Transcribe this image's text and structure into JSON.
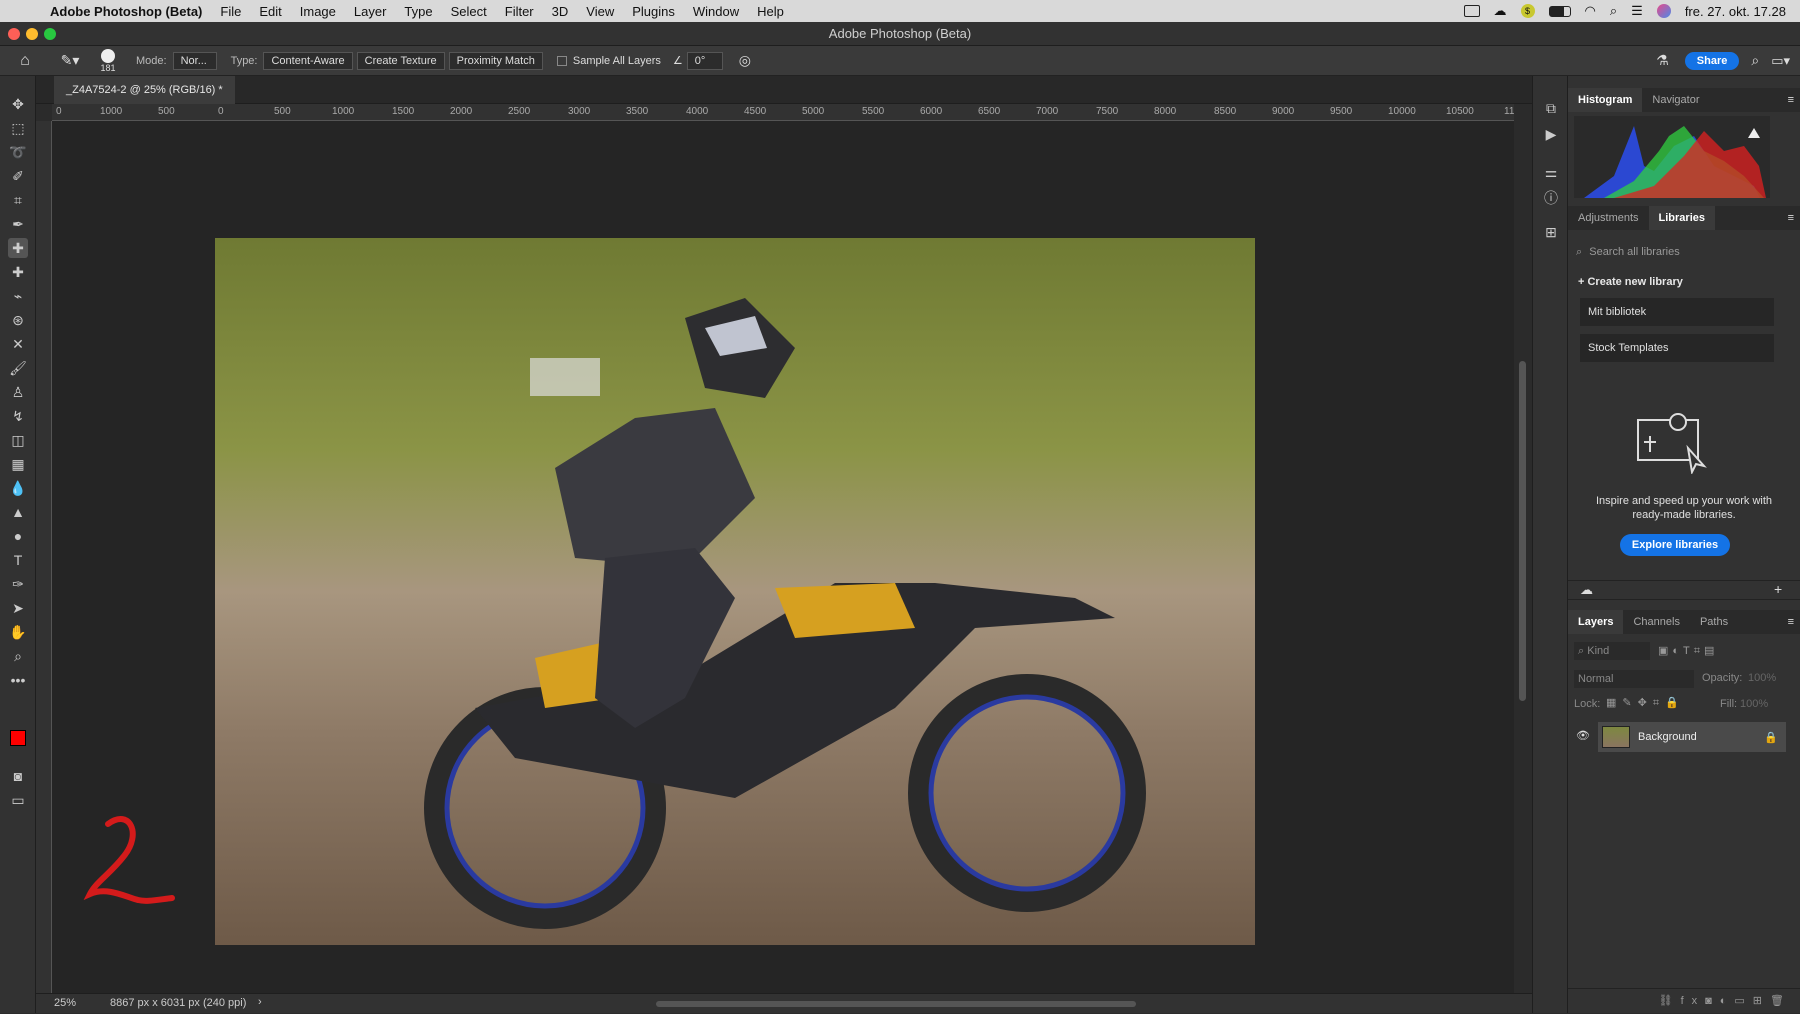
{
  "menubar": {
    "app": "Adobe Photoshop (Beta)",
    "items": [
      "File",
      "Edit",
      "Image",
      "Layer",
      "Type",
      "Select",
      "Filter",
      "3D",
      "View",
      "Plugins",
      "Window",
      "Help"
    ],
    "clock": "fre. 27. okt. 17.28"
  },
  "window": {
    "title": "Adobe Photoshop (Beta)"
  },
  "options": {
    "brush_size": "181",
    "mode_label": "Mode:",
    "mode_value": "Nor...",
    "type_label": "Type:",
    "type_buttons": [
      "Content-Aware",
      "Create Texture",
      "Proximity Match"
    ],
    "sample_all": "Sample All Layers",
    "angle": "0°",
    "share": "Share"
  },
  "document": {
    "tab": "_Z4A7524-2 @ 25% (RGB/16) *",
    "zoom": "25%",
    "info": "8867 px x 6031 px (240 ppi)"
  },
  "ruler": {
    "h_labels": [
      "0",
      "1000",
      "500",
      "0",
      "500",
      "1000",
      "1500",
      "2000",
      "2500",
      "3000",
      "3500",
      "4000",
      "4500",
      "5000",
      "5500",
      "6000",
      "6500",
      "7000",
      "7500",
      "8000",
      "8500",
      "9000",
      "9500",
      "10000",
      "10500",
      "11"
    ]
  },
  "histogram_tabs": {
    "active": "Histogram",
    "other": "Navigator"
  },
  "libraries": {
    "tabs": [
      "Adjustments",
      "Libraries"
    ],
    "search_placeholder": "Search all libraries",
    "create": "Create new library",
    "items": [
      "Mit bibliotek",
      "Stock Templates"
    ],
    "promo": "Inspire and speed up your work with ready-made libraries.",
    "explore": "Explore libraries"
  },
  "layers": {
    "tabs": [
      "Layers",
      "Channels",
      "Paths"
    ],
    "kind": "Kind",
    "blend": "Normal",
    "opacity_label": "Opacity:",
    "opacity_value": "100%",
    "lock_label": "Lock:",
    "fill_label": "Fill:",
    "fill_value": "100%",
    "layer_name": "Background"
  },
  "colors": {
    "accent": "#1473e6",
    "foreground": "#ff0000",
    "background": "#ffffff",
    "annotation": "#d41b1b"
  },
  "annotation_glyph": "2"
}
